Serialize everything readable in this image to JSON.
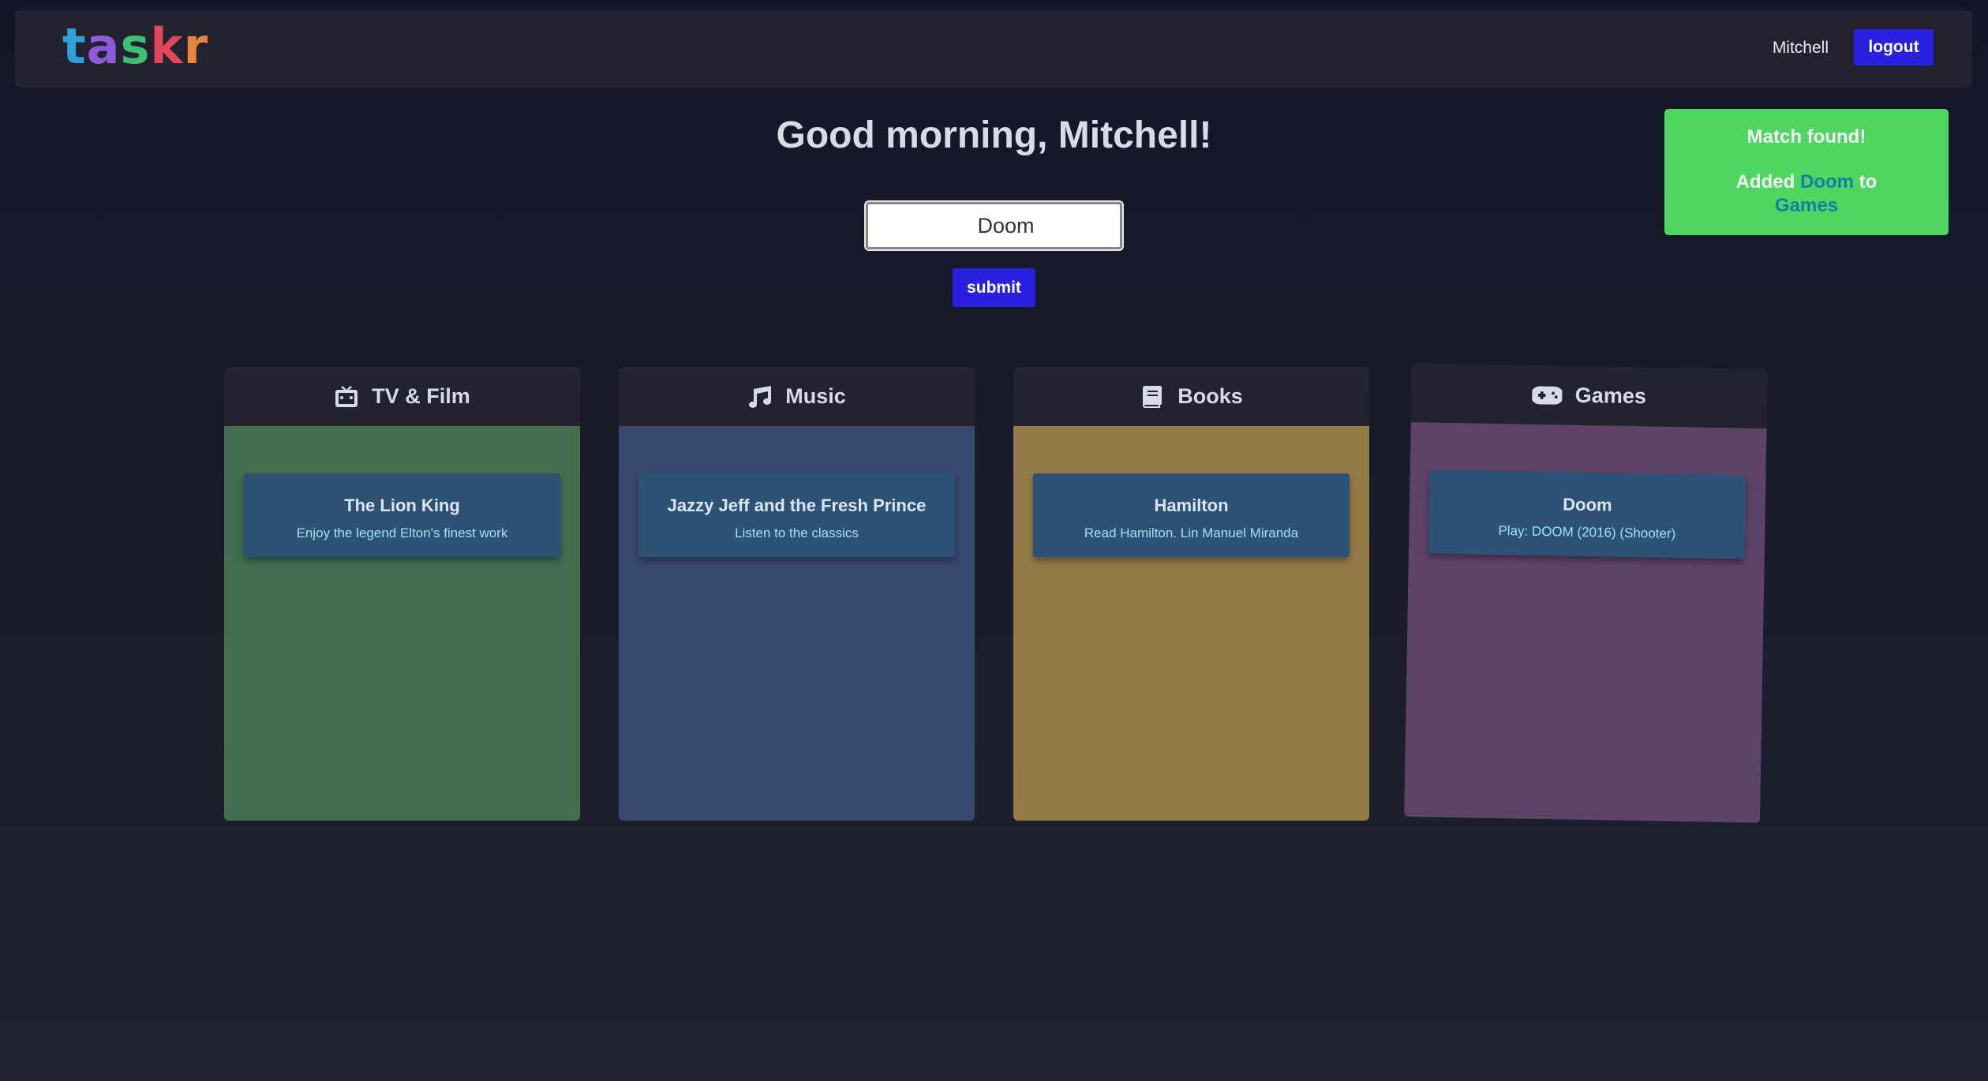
{
  "app": {
    "logo_letters": [
      "t",
      "a",
      "s",
      "k",
      "r"
    ]
  },
  "nav": {
    "username": "Mitchell",
    "logout_label": "logout"
  },
  "greeting": "Good morning, Mitchell!",
  "search": {
    "value": "Doom",
    "placeholder": ""
  },
  "submit_label": "submit",
  "toast": {
    "title": "Match found!",
    "prefix": "Added",
    "item": "Doom",
    "middle": "to",
    "category": "Games"
  },
  "columns": [
    {
      "title": "TV & Film",
      "icon": "tv-icon",
      "color": "#436e50",
      "cards": [
        {
          "title": "The Lion King",
          "subtitle": "Enjoy the legend Elton's finest work"
        }
      ]
    },
    {
      "title": "Music",
      "icon": "music-note-icon",
      "color": "#38486f",
      "cards": [
        {
          "title": "Jazzy Jeff and the Fresh Prince",
          "subtitle": "Listen to the classics"
        }
      ]
    },
    {
      "title": "Books",
      "icon": "book-icon",
      "color": "#937b48",
      "cards": [
        {
          "title": "Hamilton",
          "subtitle": "Read Hamilton. Lin Manuel Miranda"
        }
      ]
    },
    {
      "title": "Games",
      "icon": "gamepad-icon",
      "color": "#5e4369",
      "cards": [
        {
          "title": "Doom",
          "subtitle": "Play: DOOM (2016) (Shooter)"
        }
      ]
    }
  ]
}
